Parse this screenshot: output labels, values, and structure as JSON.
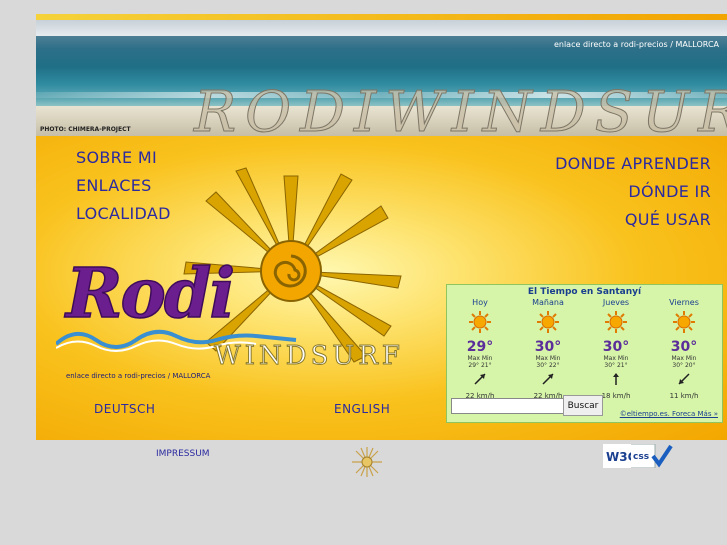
{
  "banner": {
    "title": "RODIWINDSURF",
    "link_text": "enlace directo a rodi-precios / MALLORCA",
    "photo_credit": "PHOTO: CHIMERA-PROJECT"
  },
  "nav_left": [
    "SOBRE MI",
    "ENLACES",
    "LOCALIDAD"
  ],
  "nav_right": [
    "DONDE APRENDER",
    "DÓNDE IR",
    "QUÉ USAR"
  ],
  "logo": {
    "brand_main": "Rodi",
    "brand_sub": "WINDSURF",
    "link_text": "enlace directo a rodi-precios / MALLORCA"
  },
  "languages": [
    "DEUTSCH",
    "ENGLISH"
  ],
  "weather": {
    "title": "El Tiempo en Santanyí",
    "days": [
      {
        "name": "Hoy",
        "temp": "29°",
        "max_label": "Max",
        "min_label": "Min",
        "max": "29°",
        "min": "21°",
        "wind": "22 km/h"
      },
      {
        "name": "Mañana",
        "temp": "30°",
        "max_label": "Max",
        "min_label": "Min",
        "max": "30°",
        "min": "22°",
        "wind": "22 km/h"
      },
      {
        "name": "Jueves",
        "temp": "30°",
        "max_label": "Max",
        "min_label": "Min",
        "max": "30°",
        "min": "21°",
        "wind": "18 km/h"
      },
      {
        "name": "Viernes",
        "temp": "30°",
        "max_label": "Max",
        "min_label": "Min",
        "max": "30°",
        "min": "20°",
        "wind": "11 km/h"
      }
    ],
    "search_value": "",
    "search_button": "Buscar",
    "credit": "©eltiempo.es. Foreca Más »"
  },
  "footer": {
    "impressum": "IMPRESSUM",
    "w3c_label": "W3C",
    "css_label": "css"
  },
  "colors": {
    "frame": "#f7b500",
    "nav": "#2b2aa0",
    "weather_bg": "#d6f5a9",
    "page_bg": "#d9d9d9"
  }
}
